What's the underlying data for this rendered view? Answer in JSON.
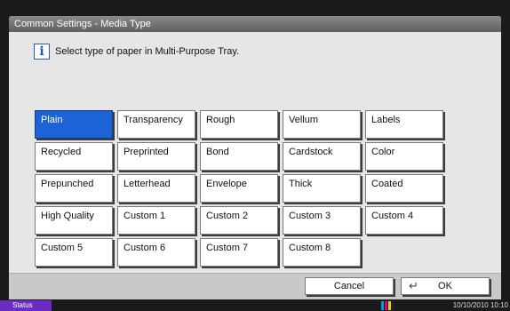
{
  "window": {
    "title": "Common Settings - Media Type"
  },
  "info": {
    "icon": "info-icon",
    "message": "Select type of paper in Multi-Purpose Tray."
  },
  "media_types": [
    {
      "label": "Plain",
      "selected": true
    },
    {
      "label": "Transparency",
      "selected": false
    },
    {
      "label": "Rough",
      "selected": false
    },
    {
      "label": "Vellum",
      "selected": false
    },
    {
      "label": "Labels",
      "selected": false
    },
    {
      "label": "Recycled",
      "selected": false
    },
    {
      "label": "Preprinted",
      "selected": false
    },
    {
      "label": "Bond",
      "selected": false
    },
    {
      "label": "Cardstock",
      "selected": false
    },
    {
      "label": "Color",
      "selected": false
    },
    {
      "label": "Prepunched",
      "selected": false
    },
    {
      "label": "Letterhead",
      "selected": false
    },
    {
      "label": "Envelope",
      "selected": false
    },
    {
      "label": "Thick",
      "selected": false
    },
    {
      "label": "Coated",
      "selected": false
    },
    {
      "label": "High Quality",
      "selected": false
    },
    {
      "label": "Custom 1",
      "selected": false
    },
    {
      "label": "Custom 2",
      "selected": false
    },
    {
      "label": "Custom 3",
      "selected": false
    },
    {
      "label": "Custom 4",
      "selected": false
    },
    {
      "label": "Custom 5",
      "selected": false
    },
    {
      "label": "Custom 6",
      "selected": false
    },
    {
      "label": "Custom 7",
      "selected": false
    },
    {
      "label": "Custom 8",
      "selected": false
    }
  ],
  "footer": {
    "cancel_label": "Cancel",
    "ok_label": "OK",
    "ok_icon": "return-arrow-icon"
  },
  "status_bar": {
    "status_label": "Status",
    "toner_icon": "toner-level-icon",
    "datetime": "10/10/2010 10:10"
  },
  "colors": {
    "selected": "#1e63d6",
    "status_button": "#6a2cc2",
    "toner": [
      "#00a0e0",
      "#e0007a",
      "#f0d000",
      "#222222"
    ]
  }
}
